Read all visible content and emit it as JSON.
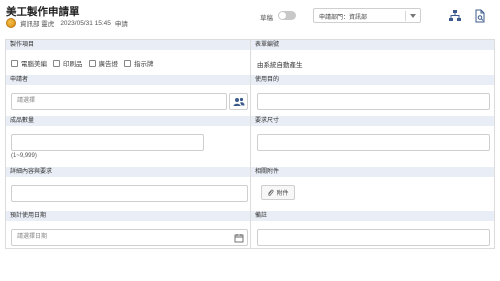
{
  "header": {
    "title": "美工製作申請單",
    "department": "資訊部 靈虎",
    "datetime": "2023/05/31 15:45",
    "status": "申請",
    "draft_label": "草稿",
    "draft_enabled": false,
    "dept_select_value": "申請部門：資訊部",
    "icons": [
      "org-chart-icon",
      "document-search-icon",
      "chevron-down-icon"
    ]
  },
  "form": {
    "production_items": {
      "label": "製作項目",
      "options": [
        "電腦美編",
        "印刷品",
        "廣告燈",
        "指示牌"
      ]
    },
    "form_number": {
      "label": "表單編號",
      "value": "由系統自動產生"
    },
    "applicant": {
      "label": "申請者",
      "placeholder": "請選擇",
      "icon": "users-icon"
    },
    "purpose": {
      "label": "使用目的",
      "value": ""
    },
    "quantity": {
      "label": "成品數量",
      "value": "",
      "hint": "(1~9,999)"
    },
    "size": {
      "label": "要求尺寸",
      "value": ""
    },
    "details": {
      "label": "詳細內容與要求",
      "value": ""
    },
    "attachments": {
      "label": "相關附件",
      "button_label": "附件",
      "icon": "paperclip-icon"
    },
    "expected_date": {
      "label": "預計使用日期",
      "placeholder": "請選擇日期",
      "icon": "calendar-icon"
    },
    "remarks": {
      "label": "備註",
      "value": ""
    }
  }
}
